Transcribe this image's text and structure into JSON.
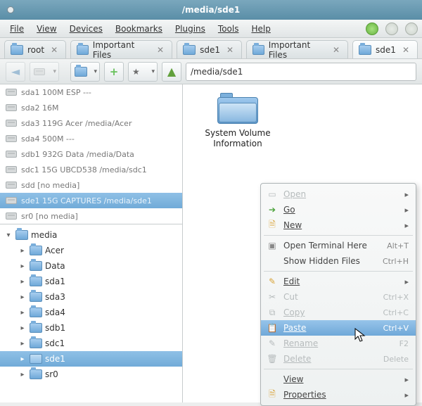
{
  "window": {
    "title": "/media/sde1"
  },
  "menu": {
    "file": "File",
    "view": "View",
    "devices": "Devices",
    "bookmarks": "Bookmarks",
    "plugins": "Plugins",
    "tools": "Tools",
    "help": "Help"
  },
  "tabs": [
    {
      "label": "root",
      "active": false
    },
    {
      "label": "Important Files",
      "active": false
    },
    {
      "label": "sde1",
      "active": false
    },
    {
      "label": "Important Files",
      "active": false
    },
    {
      "label": "sde1",
      "active": true
    }
  ],
  "path": {
    "value": "/media/sde1"
  },
  "devices": [
    {
      "label": "sda1 100M ESP ---",
      "selected": false
    },
    {
      "label": "sda2 16M",
      "selected": false
    },
    {
      "label": "sda3 119G Acer /media/Acer",
      "selected": false
    },
    {
      "label": "sda4 500M ---",
      "selected": false
    },
    {
      "label": "sdb1 932G Data /media/Data",
      "selected": false
    },
    {
      "label": "sdc1 15G UBCD538 /media/sdc1",
      "selected": false
    },
    {
      "label": "sdd [no media]",
      "selected": false
    },
    {
      "label": "sde1 15G CAPTURES /media/sde1",
      "selected": true
    },
    {
      "label": "sr0 [no media]",
      "selected": false
    }
  ],
  "tree": {
    "root": "media",
    "children": [
      "Acer",
      "Data",
      "sda1",
      "sda3",
      "sda4",
      "sdb1",
      "sdc1",
      "sde1",
      "sr0"
    ],
    "selected": "sde1"
  },
  "files": [
    {
      "name_line1": "System Volume",
      "name_line2": "Information"
    }
  ],
  "context_menu": {
    "open": "Open",
    "go": "Go",
    "new": "New",
    "open_terminal": "Open Terminal Here",
    "open_terminal_accel": "Alt+T",
    "show_hidden": "Show Hidden Files",
    "show_hidden_accel": "Ctrl+H",
    "edit": "Edit",
    "cut": "Cut",
    "cut_accel": "Ctrl+X",
    "copy": "Copy",
    "copy_accel": "Ctrl+C",
    "paste": "Paste",
    "paste_accel": "Ctrl+V",
    "rename": "Rename",
    "rename_accel": "F2",
    "delete": "Delete",
    "delete_accel": "Delete",
    "view": "View",
    "properties": "Properties"
  }
}
